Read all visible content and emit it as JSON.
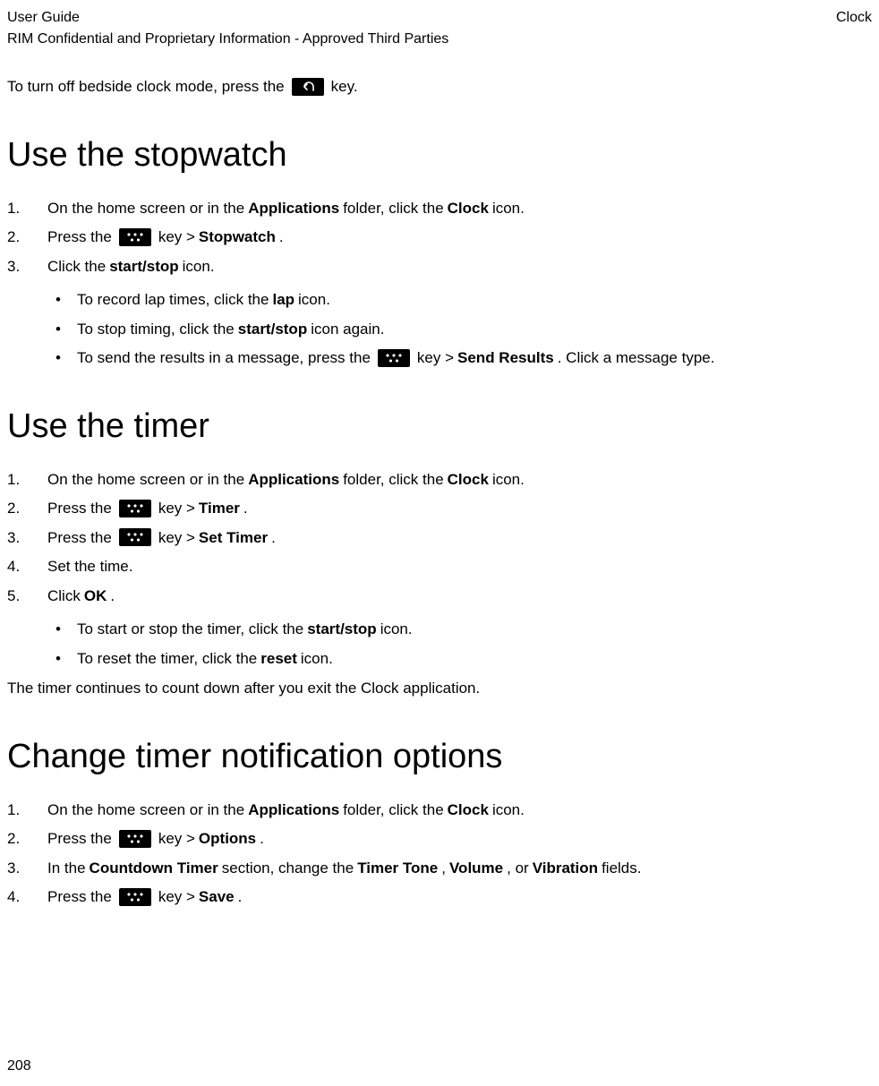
{
  "header": {
    "guideTitle": "User Guide",
    "confidential": "RIM Confidential and Proprietary Information - Approved Third Parties",
    "section": "Clock"
  },
  "intro": {
    "pre": "To turn off bedside clock mode, press the ",
    "post": " key."
  },
  "sections": {
    "stopwatch": {
      "heading": "Use the stopwatch",
      "steps": {
        "s1": {
          "num": "1.",
          "pre": "On the home screen or in the ",
          "b1": "Applications",
          "mid": " folder, click the ",
          "b2": "Clock",
          "post": " icon."
        },
        "s2": {
          "num": "2.",
          "pre": " Press the ",
          "mid": " key > ",
          "b1": "Stopwatch",
          "post": "."
        },
        "s3": {
          "num": "3.",
          "pre": "Click the ",
          "b1": "start/stop",
          "post": " icon."
        }
      },
      "bullets": {
        "b1": {
          "pre": "To record lap times, click the ",
          "bold": "lap",
          "post": " icon."
        },
        "b2": {
          "pre": "To stop timing, click the ",
          "bold": "start/stop",
          "post": " icon again."
        },
        "b3": {
          "pre": "To send the results in a message, press the ",
          "mid": " key > ",
          "bold": "Send Results",
          "post": ". Click a message type."
        }
      }
    },
    "timer": {
      "heading": "Use the timer",
      "steps": {
        "s1": {
          "num": "1.",
          "pre": "On the home screen or in the ",
          "b1": "Applications",
          "mid": " folder, click the ",
          "b2": "Clock",
          "post": " icon."
        },
        "s2": {
          "num": "2.",
          "pre": " Press the ",
          "mid": " key > ",
          "b1": "Timer",
          "post": "."
        },
        "s3": {
          "num": "3.",
          "pre": " Press the ",
          "mid": " key > ",
          "b1": "Set Timer",
          "post": "."
        },
        "s4": {
          "num": "4.",
          "pre": "Set the time."
        },
        "s5": {
          "num": "5.",
          "pre": "Click ",
          "b1": "OK",
          "post": "."
        }
      },
      "bullets": {
        "b1": {
          "pre": "To start or stop the timer, click the ",
          "bold": "start/stop",
          "post": " icon."
        },
        "b2": {
          "pre": "To reset the timer, click the ",
          "bold": "reset",
          "post": " icon."
        }
      },
      "bodyText": "The timer continues to count down after you exit the Clock application."
    },
    "notifications": {
      "heading": "Change timer notification options",
      "steps": {
        "s1": {
          "num": "1.",
          "pre": "On the home screen or in the ",
          "b1": "Applications",
          "mid": " folder, click the ",
          "b2": "Clock",
          "post": " icon."
        },
        "s2": {
          "num": "2.",
          "pre": " Press the ",
          "mid": " key > ",
          "b1": "Options",
          "post": "."
        },
        "s3": {
          "num": "3.",
          "pre": "In the ",
          "b1": "Countdown Timer",
          "mid1": " section, change the ",
          "b2": "Timer Tone",
          "mid2": ", ",
          "b3": "Volume",
          "mid3": ", or ",
          "b4": "Vibration",
          "post": " fields."
        },
        "s4": {
          "num": "4.",
          "pre": " Press the ",
          "mid": " key > ",
          "b1": "Save",
          "post": "."
        }
      }
    }
  },
  "pageNumber": "208"
}
